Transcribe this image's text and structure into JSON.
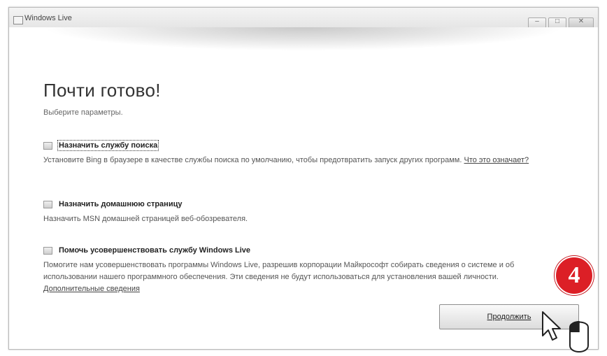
{
  "window": {
    "title": "Windows Live"
  },
  "page": {
    "heading": "Почти готово!",
    "subheading": "Выберите параметры."
  },
  "options": [
    {
      "label": "Назначить службу поиска",
      "description": "Установите Bing в браузере в качестве службы поиска по умолчанию, чтобы предотвратить запуск других программ.",
      "link": "Что это означает?"
    },
    {
      "label": "Назначить домашнюю страницу",
      "description": "Назначить MSN домашней страницей веб-обозревателя."
    },
    {
      "label": "Помочь усовершенствовать службу Windows Live",
      "description": "Помогите нам усовершенствовать программы Windows Live, разрешив корпорации Майкрософт собирать сведения о системе и об использовании нашего программного обеспечения. Эти сведения не будут использоваться для установления вашей личности.",
      "link": "Дополнительные сведения"
    }
  ],
  "buttons": {
    "continue": "Продолжить"
  },
  "annotation": {
    "step_number": "4",
    "color": "#dc1f26"
  },
  "icons": [
    "window-icon",
    "minimize-icon",
    "maximize-icon",
    "close-icon",
    "checkbox-icon",
    "mouse-cursor-icon"
  ]
}
